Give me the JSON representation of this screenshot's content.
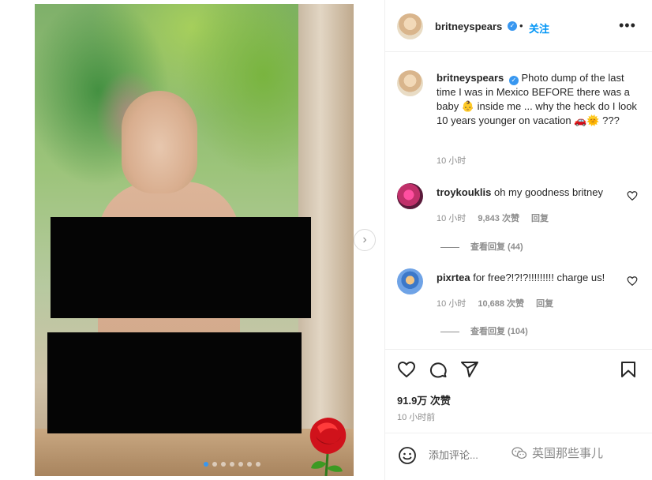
{
  "post": {
    "username": "britneyspears",
    "follow_label": "关注",
    "dot": "•",
    "more_glyph": "•••",
    "verified_glyph": "✓",
    "caption_username": "britneyspears",
    "caption_text": "Photo dump of the last time I was in Mexico BEFORE there was a baby 👶 inside me ... why the heck do I look 10 years younger on vacation 🚗🌞 ???",
    "caption_time": "10 小时",
    "likes": "91.9万 次赞",
    "post_time": "10 小时前",
    "add_comment_placeholder": "添加评论...",
    "watermark": "英国那些事儿",
    "next_glyph": "›"
  },
  "comments": [
    {
      "username": "troykouklis",
      "text": "oh my goodness britney",
      "time": "10 小时",
      "likes": "9,843 次赞",
      "reply": "回复",
      "view_replies": "查看回复 (44)"
    },
    {
      "username": "pixrtea",
      "text": "for free?!?!?!!!!!!!!! charge us!",
      "time": "10 小时",
      "likes": "10,688 次赞",
      "reply": "回复",
      "view_replies": "查看回复 (104)"
    }
  ],
  "icons": {
    "like": "heart-icon",
    "comment": "comment-icon",
    "share": "share-icon",
    "save": "bookmark-icon",
    "emoji": "emoji-icon",
    "more": "more-icon",
    "next": "chevron-right-icon"
  },
  "colors": {
    "accent": "#0095f6",
    "verified": "#3897f0",
    "muted": "#8e8e8e",
    "text": "#262626",
    "censor": "#050505"
  },
  "carousel": {
    "slide_count": 7,
    "active_index": 0
  }
}
